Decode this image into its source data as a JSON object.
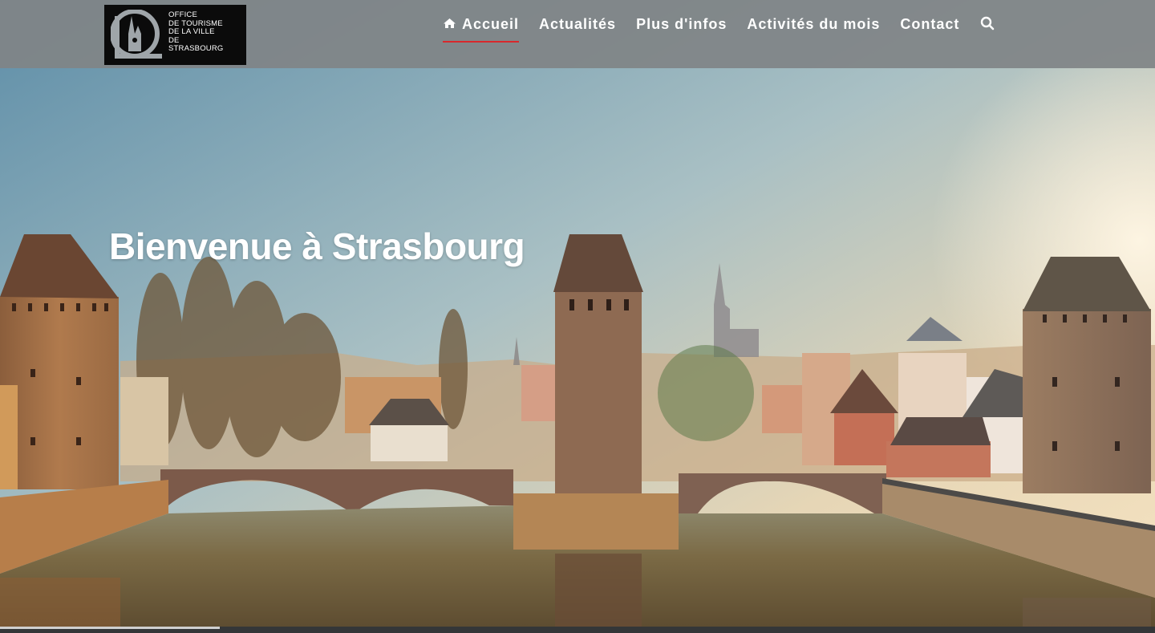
{
  "logo": {
    "lines": [
      "OFFICE",
      "DE TOURISME",
      "DE LA VILLE",
      "DE",
      "STRASBOURG"
    ],
    "icon": "cathedral-icon"
  },
  "nav": {
    "items": [
      {
        "label": "Accueil",
        "active": true,
        "icon": "home-icon"
      },
      {
        "label": "Actualités",
        "active": false
      },
      {
        "label": "Plus d'infos",
        "active": false
      },
      {
        "label": "Activités du mois",
        "active": false
      },
      {
        "label": "Contact",
        "active": false
      }
    ],
    "search_icon": "search-icon"
  },
  "hero": {
    "title": "Bienvenue à Strasbourg",
    "image": "strasbourg-ponts-couverts-panorama"
  },
  "slider": {
    "progress": 0.19
  },
  "colors": {
    "header_bg": "#808487",
    "active_underline": "#d8282c",
    "logo_bg": "#0b0b0b",
    "text": "#ffffff"
  }
}
